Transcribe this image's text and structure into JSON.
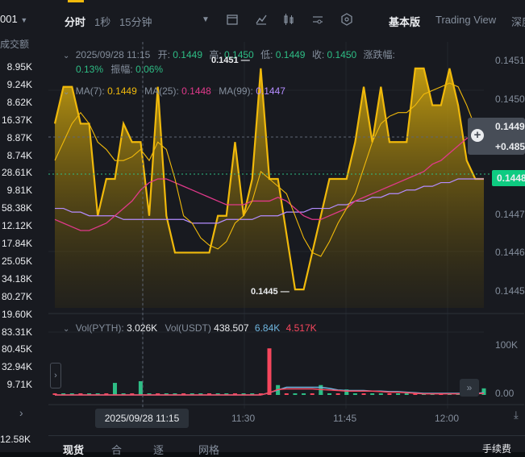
{
  "left_panel": {
    "header_value": "001",
    "column_label": "成交额",
    "amounts": [
      "8.95K",
      "9.24K",
      "8.62K",
      "16.37K",
      "8.87K",
      "8.74K",
      "28.61K",
      "9.81K",
      "58.38K",
      "12.12K",
      "17.84K",
      "25.05K",
      "34.18K",
      "80.27K",
      "19.60K",
      "83.31K",
      "80.45K",
      "32.94K",
      "9.71K"
    ],
    "bottom_value": "12.58K"
  },
  "toolbar": {
    "items": [
      "分时",
      "1秒",
      "15分钟"
    ],
    "view_basic": "基本版",
    "view_tradingview": "Trading View",
    "view_depth": "深度"
  },
  "ohlc": {
    "datetime": "2025/09/28 11:15",
    "open_label": "开:",
    "open": "0.1449",
    "high_label": "高:",
    "high": "0.1450",
    "low_label": "低:",
    "low": "0.1449",
    "close_label": "收:",
    "close": "0.1450",
    "change_label": "涨跌幅:",
    "change": "0.13%",
    "amplitude_label": "振幅:",
    "amplitude": "0.06%"
  },
  "ma": {
    "ma7_label": "MA(7):",
    "ma7": "0.1449",
    "ma25_label": "MA(25):",
    "ma25": "0.1448",
    "ma99_label": "MA(99):",
    "ma99": "0.1447"
  },
  "volume": {
    "pyth_label": "Vol(PYTH):",
    "pyth": "3.026K",
    "usdt_label": "Vol(USDT)",
    "usdt": "438.507",
    "v1": "6.84K",
    "v2": "4.517K",
    "axis": [
      "100K",
      "0.00"
    ]
  },
  "price_axis": [
    "0.1451",
    "0.1450",
    "0.1447",
    "0.1446",
    "0.1445"
  ],
  "price_tags": {
    "crosshair_price": "0.1449",
    "crosshair_change": "+0.485",
    "last_price": "0.1448"
  },
  "annotations": {
    "high_mark": "0.1451",
    "low_mark": "0.1445"
  },
  "time_axis": {
    "cursor": "2025/09/28 11:15",
    "ticks": [
      "11:30",
      "11:45",
      "12:00"
    ]
  },
  "bottom_tabs": [
    "现货",
    "合",
    " 逐",
    " 网格",
    "手续费"
  ],
  "colors": {
    "accent": "#f0b90b",
    "up": "#2ebd85",
    "down": "#f6465d",
    "ma25": "#e0398a",
    "ma99": "#b48cff"
  },
  "chart_data": {
    "type": "area",
    "x_ticks": [
      "11:30",
      "11:45",
      "12:00"
    ],
    "ylim": [
      0.14445,
      0.14515
    ],
    "price_series": [
      0.14495,
      0.14505,
      0.14505,
      0.14495,
      0.14495,
      0.1447,
      0.1448,
      0.1448,
      0.14495,
      0.1449,
      0.1449,
      0.1447,
      0.14505,
      0.1447,
      0.1446,
      0.1446,
      0.1446,
      0.1446,
      0.1446,
      0.1447,
      0.1447,
      0.1449,
      0.1447,
      0.1448,
      0.1451,
      0.1448,
      0.1448,
      0.14465,
      0.1445,
      0.1445,
      0.1446,
      0.1447,
      0.1448,
      0.1448,
      0.1448,
      0.1449,
      0.14505,
      0.1449,
      0.14505,
      0.1449,
      0.1449,
      0.1449,
      0.1451,
      0.1451,
      0.145,
      0.145,
      0.1451,
      0.145,
      0.14485,
      0.1448,
      0.1448
    ],
    "ma7": [
      0.14485,
      0.1449,
      0.14495,
      0.14498,
      0.14495,
      0.1449,
      0.14488,
      0.14485,
      0.14485,
      0.14486,
      0.14488,
      0.14485,
      0.1449,
      0.14488,
      0.1448,
      0.1447,
      0.14468,
      0.14464,
      0.14462,
      0.14461,
      0.14463,
      0.14468,
      0.1447,
      0.14474,
      0.14482,
      0.1448,
      0.14478,
      0.14476,
      0.1447,
      0.14464,
      0.1446,
      0.14459,
      0.14463,
      0.14468,
      0.14472,
      0.14476,
      0.14483,
      0.1449,
      0.14495,
      0.14497,
      0.14498,
      0.14498,
      0.145,
      0.14503,
      0.14504,
      0.14505,
      0.14506,
      0.14505,
      0.145,
      0.14494,
      0.14488
    ],
    "ma25": [
      0.14469,
      0.14468,
      0.14467,
      0.14466,
      0.14466,
      0.14467,
      0.14468,
      0.1447,
      0.14472,
      0.14474,
      0.14477,
      0.14479,
      0.1448,
      0.1448,
      0.14479,
      0.14478,
      0.14477,
      0.14476,
      0.14475,
      0.14474,
      0.14473,
      0.14473,
      0.14473,
      0.14474,
      0.14474,
      0.14474,
      0.14475,
      0.14474,
      0.14472,
      0.1447,
      0.14469,
      0.14469,
      0.1447,
      0.14471,
      0.14472,
      0.14474,
      0.14475,
      0.14476,
      0.14477,
      0.14478,
      0.14479,
      0.1448,
      0.14481,
      0.14482,
      0.14484,
      0.14485,
      0.14487,
      0.14489,
      0.14491,
      0.14492,
      0.14493
    ],
    "ma99": [
      0.14472,
      0.14472,
      0.14471,
      0.14471,
      0.1447,
      0.1447,
      0.1447,
      0.1447,
      0.14469,
      0.14469,
      0.14469,
      0.14469,
      0.14469,
      0.14469,
      0.14469,
      0.14469,
      0.14468,
      0.14468,
      0.14468,
      0.14468,
      0.14469,
      0.14469,
      0.14469,
      0.14469,
      0.1447,
      0.1447,
      0.1447,
      0.14471,
      0.14471,
      0.14471,
      0.14472,
      0.14472,
      0.14472,
      0.14473,
      0.14473,
      0.14474,
      0.14474,
      0.14475,
      0.14475,
      0.14476,
      0.14476,
      0.14477,
      0.14477,
      0.14478,
      0.14478,
      0.14479,
      0.14479,
      0.1448,
      0.1448,
      0.1448,
      0.1448
    ],
    "volume_ylim": [
      0,
      100000
    ],
    "volume_up": [
      0,
      0,
      0,
      0,
      0,
      0,
      0,
      0,
      0,
      0,
      0,
      0,
      0,
      0,
      0,
      0,
      0,
      0,
      0,
      0,
      0,
      0,
      0,
      0,
      0,
      0,
      18000,
      0,
      0,
      0,
      0,
      18000,
      0,
      0,
      10000,
      0,
      0,
      0,
      0,
      0,
      0,
      0,
      0,
      0,
      0,
      0,
      0,
      0,
      0,
      0,
      12000
    ],
    "volume_up_b": [
      0,
      0,
      0,
      0,
      0,
      0,
      0,
      22000,
      0,
      0,
      25000,
      0,
      0,
      0,
      0,
      0,
      0,
      0,
      0,
      0,
      0,
      0,
      0,
      0,
      0,
      0,
      0,
      0,
      0,
      0,
      0,
      0,
      0,
      0,
      0,
      0,
      0,
      0,
      0,
      0,
      0,
      0,
      0,
      0,
      0,
      0,
      0,
      0,
      0,
      0,
      0
    ],
    "volume_down": [
      0,
      0,
      0,
      0,
      0,
      0,
      0,
      0,
      0,
      0,
      0,
      0,
      0,
      0,
      0,
      0,
      0,
      0,
      0,
      0,
      0,
      0,
      0,
      0,
      0,
      85000,
      0,
      0,
      0,
      0,
      0,
      0,
      0,
      0,
      0,
      0,
      0,
      0,
      0,
      0,
      0,
      0,
      0,
      0,
      0,
      0,
      0,
      0,
      0,
      0,
      0
    ],
    "vol_ma_a": [
      0,
      0,
      0,
      0,
      0,
      0,
      0,
      0,
      0,
      0,
      0,
      0,
      0,
      0,
      0,
      0,
      0,
      0,
      0,
      0,
      0,
      0,
      0,
      0,
      0,
      4000,
      9000,
      14000,
      14000,
      14000,
      14000,
      14000,
      12000,
      9000,
      8000,
      8000,
      8000,
      7000,
      7000,
      6000,
      6000,
      5000,
      4000,
      3000,
      3000,
      3000,
      3000,
      3000,
      3000,
      3000,
      4000
    ],
    "vol_ma_b": [
      0,
      0,
      0,
      0,
      0,
      0,
      0,
      0,
      0,
      0,
      0,
      0,
      0,
      0,
      0,
      0,
      0,
      0,
      0,
      0,
      0,
      0,
      0,
      0,
      0,
      4000,
      10000,
      11000,
      11000,
      11000,
      11000,
      10000,
      9000,
      8000,
      7000,
      7000,
      7000,
      7000,
      6000,
      5000,
      5000,
      4000,
      3000,
      2000,
      2000,
      2000,
      2000,
      2000,
      2000,
      2000,
      3000
    ]
  }
}
